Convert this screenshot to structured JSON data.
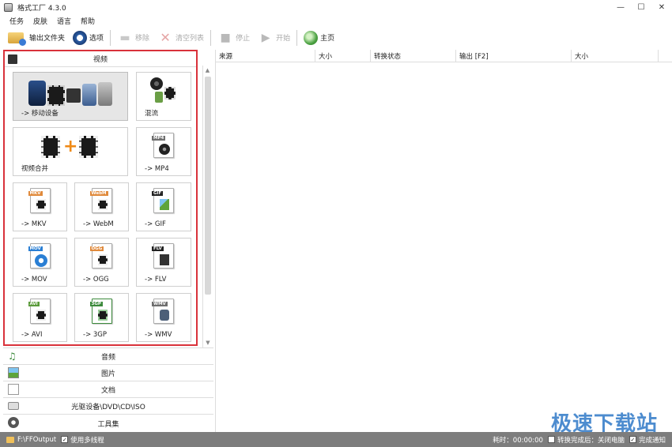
{
  "window": {
    "title": "格式工厂 4.3.0",
    "minimize": "—",
    "maximize": "☐",
    "close": "✕"
  },
  "menu": [
    "任务",
    "皮肤",
    "语言",
    "帮助"
  ],
  "toolbar": {
    "output_folder": "输出文件夹",
    "options": "选项",
    "remove": "移除",
    "clear_list": "清空列表",
    "stop": "停止",
    "start": "开始",
    "home": "主页"
  },
  "left": {
    "video_header": "视频",
    "tiles": [
      {
        "label": "-> 移动设备"
      },
      {
        "label": "混流"
      },
      {
        "label": "视频合并"
      },
      {
        "label": "-> MP4",
        "tag": "MP4",
        "color": "#6e6e6e"
      },
      {
        "label": "-> MKV",
        "tag": "MKV",
        "color": "#e08a3c"
      },
      {
        "label": "-> WebM",
        "tag": "WebM",
        "color": "#e08a3c"
      },
      {
        "label": "-> GIF",
        "tag": "GIF",
        "color": "#222222"
      },
      {
        "label": "-> MOV",
        "tag": "MOV",
        "color": "#2a7fd4"
      },
      {
        "label": "-> OGG",
        "tag": "OGG",
        "color": "#e08a3c"
      },
      {
        "label": "-> FLV",
        "tag": "FLV",
        "color": "#222222"
      },
      {
        "label": "-> AVI",
        "tag": "AVI",
        "color": "#5a9a3a"
      },
      {
        "label": "-> 3GP",
        "tag": "3GP",
        "color": "#3c8a3c"
      },
      {
        "label": "-> WMV",
        "tag": "WMV",
        "color": "#6e6e6e"
      }
    ],
    "categories": [
      "音频",
      "图片",
      "文档",
      "光驱设备\\DVD\\CD\\ISO",
      "工具集"
    ]
  },
  "list": {
    "columns": [
      "来源",
      "大小",
      "转换状态",
      "输出 [F2]",
      "大小"
    ]
  },
  "status": {
    "output_path": "F:\\FFOutput",
    "multithread": "使用多线程",
    "elapsed": "耗时：00:00:00",
    "after_convert": "转换完成后：关闭电脑",
    "notify": "完成通知"
  },
  "watermark": "极速下载站"
}
